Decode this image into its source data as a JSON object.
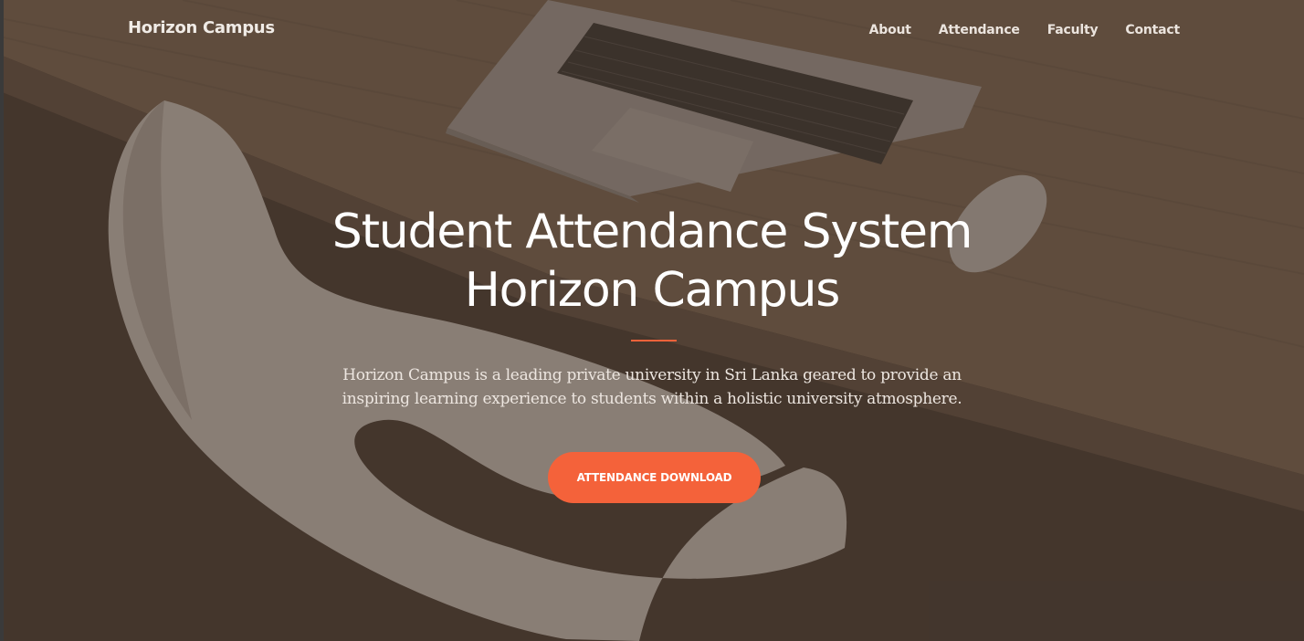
{
  "navbar": {
    "brand": "Horizon Campus",
    "links": [
      "About",
      "Attendance",
      "Faculty",
      "Contact"
    ]
  },
  "hero": {
    "headline_lines": [
      "Student Attendance System",
      "Horizon Campus"
    ],
    "lead_lines": [
      "Horizon Campus is a leading private university in Sri Lanka geared to provide an",
      "inspiring learning experience to students within a holistic university atmosphere."
    ],
    "cta_label": "ATTENDANCE DOWNLOAD"
  },
  "colors": {
    "accent": "#f4623a",
    "overlay": "#48382e",
    "text": "#ffffff"
  }
}
